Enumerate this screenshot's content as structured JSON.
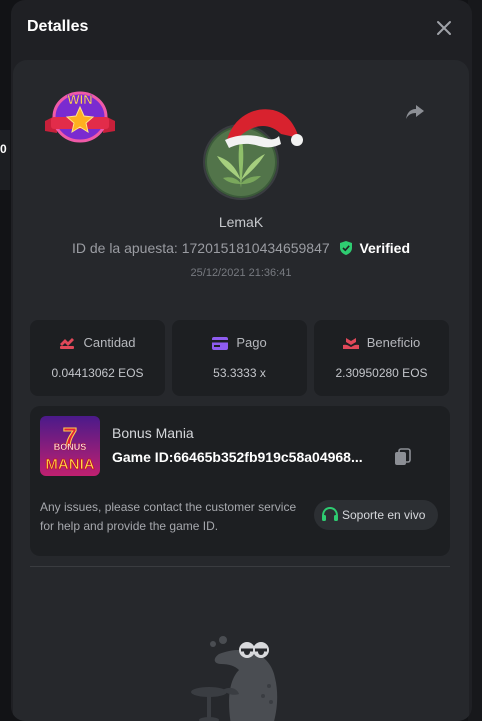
{
  "modal": {
    "title": "Detalles",
    "close_icon": "close-icon"
  },
  "background": {
    "left_fragment": "0"
  },
  "bet": {
    "badge": "WIN",
    "share_icon": "share-icon",
    "username": "LemaK",
    "id_label": "ID de la apuesta:",
    "id_value": "1720151810434659847",
    "verified": "Verified",
    "timestamp": "25/12/2021 21:36:41"
  },
  "stats": [
    {
      "label": "Cantidad",
      "value": "0.04413062 EOS",
      "icon": "amount-icon",
      "color": "#e04859"
    },
    {
      "label": "Pago",
      "value": "53.3333 x",
      "icon": "card-icon",
      "color": "#8e5cf0"
    },
    {
      "label": "Beneficio",
      "value": "2.30950280 EOS",
      "icon": "profit-icon",
      "color": "#e04859"
    }
  ],
  "game": {
    "thumb_text_top": "BONUS",
    "thumb_text_bottom": "MANIA",
    "name": "Bonus Mania",
    "game_id_label": "Game ID:",
    "game_id_value": "66465b352fb919c58a04968...",
    "copy_icon": "copy-icon",
    "issues_text": "Any issues, please contact the customer service for help and provide the game ID.",
    "support_label": "Soporte en vivo",
    "support_icon": "headset-icon"
  },
  "colors": {
    "accent_green": "#2ecc71",
    "modal_bg": "#1f2024",
    "panel_bg": "#26282c"
  }
}
